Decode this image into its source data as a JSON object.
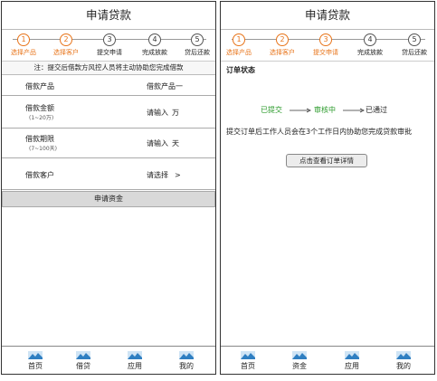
{
  "left": {
    "title": "申请贷款",
    "steps": [
      {
        "num": "1",
        "label": "选择产品",
        "active": true
      },
      {
        "num": "2",
        "label": "选择客户",
        "active": true
      },
      {
        "num": "3",
        "label": "提交申请",
        "active": false
      },
      {
        "num": "4",
        "label": "完成放款",
        "active": false
      },
      {
        "num": "5",
        "label": "贷后还款",
        "active": false
      }
    ],
    "notice": "注：提交后借款方风控人员将主动协助您完成借款",
    "form": {
      "product": {
        "label": "借款产品",
        "value": "借款产品一"
      },
      "amount": {
        "label": "借款金额",
        "sub": "(1~20万)",
        "placeholder": "请输入",
        "unit": "万"
      },
      "term": {
        "label": "借款期限",
        "sub": "(7~100天)",
        "placeholder": "请输入",
        "unit": "天"
      },
      "customer": {
        "label": "借款客户",
        "value": "请选择",
        "chevron": ">"
      }
    },
    "submit_label": "申请资金",
    "tabs": [
      {
        "label": "首页",
        "icon": "mountain-image-icon"
      },
      {
        "label": "借贷",
        "icon": "mountain-image-icon"
      },
      {
        "label": "应用",
        "icon": "mountain-image-icon"
      },
      {
        "label": "我的",
        "icon": "mountain-image-icon"
      }
    ]
  },
  "right": {
    "title": "申请贷款",
    "steps": [
      {
        "num": "1",
        "label": "选择产品",
        "active": true
      },
      {
        "num": "2",
        "label": "选择客户",
        "active": true
      },
      {
        "num": "3",
        "label": "提交申请",
        "active": true
      },
      {
        "num": "4",
        "label": "完成放款",
        "active": false
      },
      {
        "num": "5",
        "label": "贷后还款",
        "active": false
      }
    ],
    "status_title": "订单状态",
    "flow": [
      "已提交",
      "审核中",
      "已通过"
    ],
    "status_note": "提交订单后工作人员会在3个工作日内协助您完成贷款审批",
    "detail_button": "点击查看订单详情",
    "tabs": [
      {
        "label": "首页",
        "icon": "mountain-image-icon"
      },
      {
        "label": "资金",
        "icon": "mountain-image-icon"
      },
      {
        "label": "应用",
        "icon": "mountain-image-icon"
      },
      {
        "label": "我的",
        "icon": "mountain-image-icon"
      }
    ]
  },
  "colors": {
    "accent": "#e8741a",
    "flow_done": "#2a9a2a",
    "tab_icon": "#2f7fc2"
  }
}
